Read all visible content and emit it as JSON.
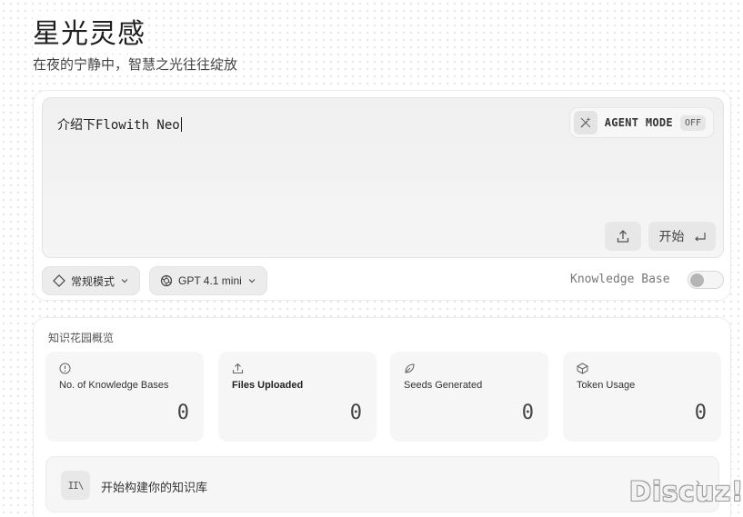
{
  "header": {
    "title": "星光灵感",
    "subtitle": "在夜的宁静中，智慧之光往往绽放"
  },
  "composer": {
    "input_text": "介绍下Flowith Neo",
    "agent_mode": {
      "label": "AGENT MODE",
      "state": "OFF"
    },
    "upload_icon": "upload-icon",
    "start_label": "开始",
    "start_icon": "enter-key-icon",
    "mode_chip": {
      "label": "常规模式",
      "icon": "diamond-icon"
    },
    "model_chip": {
      "label": "GPT 4.1 mini",
      "icon": "openai-icon"
    },
    "knowledge_base": {
      "label": "Knowledge Base",
      "enabled": false
    }
  },
  "overview": {
    "title": "知识花园概览",
    "stats": [
      {
        "label": "No. of Knowledge Bases",
        "value": "0",
        "icon": "info-icon"
      },
      {
        "label": "Files Uploaded",
        "value": "0",
        "icon": "upload-icon"
      },
      {
        "label": "Seeds Generated",
        "value": "0",
        "icon": "seed-icon"
      },
      {
        "label": "Token Usage",
        "value": "0",
        "icon": "cube-icon"
      }
    ],
    "cta": {
      "icon_text": "II\\",
      "label": "开始构建你的知识库",
      "chevron": "›"
    }
  },
  "watermark": "Discuz!",
  "colors": {
    "background": "#ffffff",
    "panel": "#f6f6f6",
    "chip": "#ececec",
    "text": "#222222"
  }
}
